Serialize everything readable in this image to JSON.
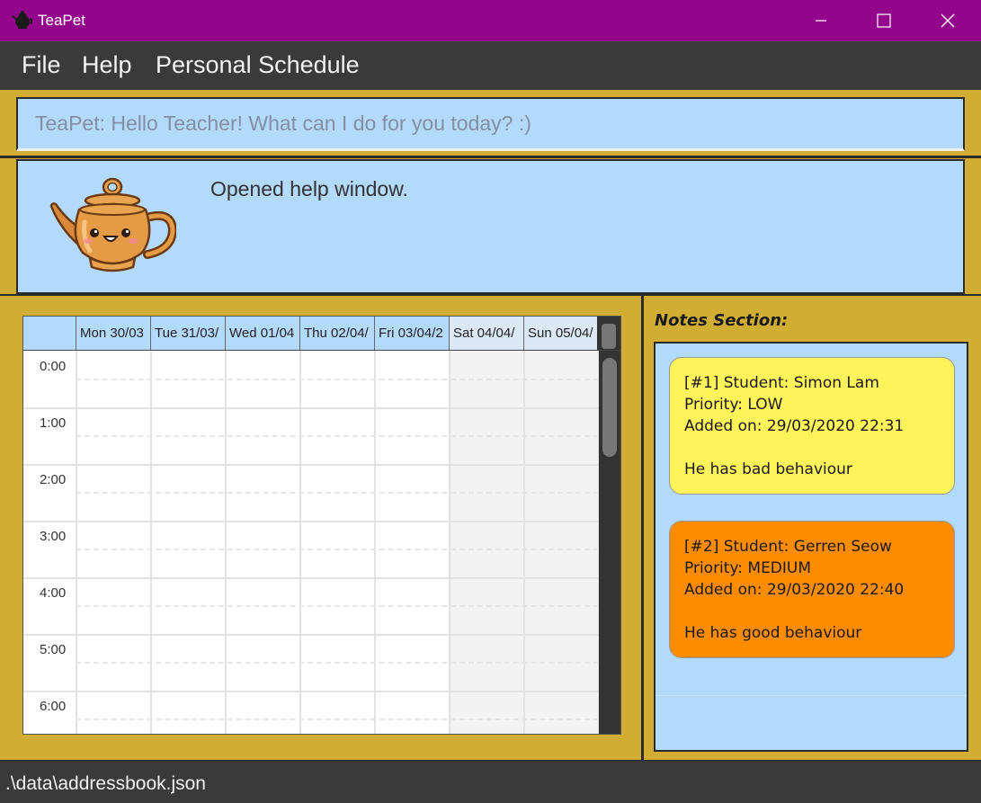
{
  "window": {
    "title": "TeaPet",
    "icon": "teapot-icon",
    "controls": {
      "minimize": "minimize-icon",
      "maximize": "maximize-icon",
      "close": "close-icon"
    }
  },
  "menu": {
    "file": "File",
    "help": "Help",
    "schedule": "Personal Schedule"
  },
  "command": {
    "placeholder": "TeaPet: Hello Teacher! What can I do for you today? :)",
    "value": ""
  },
  "result": {
    "message": "Opened help window.",
    "mascot": "teapot-mascot"
  },
  "calendar": {
    "days": [
      {
        "label": "Mon 30/03",
        "weekend": false
      },
      {
        "label": "Tue 31/03/",
        "weekend": false
      },
      {
        "label": "Wed 01/04",
        "weekend": false
      },
      {
        "label": "Thu 02/04/",
        "weekend": false
      },
      {
        "label": "Fri 03/04/2",
        "weekend": false
      },
      {
        "label": "Sat 04/04/",
        "weekend": true
      },
      {
        "label": "Sun 05/04/",
        "weekend": true
      }
    ],
    "times": [
      "0:00",
      "1:00",
      "2:00",
      "3:00",
      "4:00",
      "5:00",
      "6:00"
    ]
  },
  "notes": {
    "title": "Notes Section:",
    "items": [
      {
        "header": "[#1] Student: Simon Lam",
        "priority": "Priority: LOW",
        "added": "Added on: 29/03/2020 22:31",
        "content": "He has bad behaviour",
        "color": "#fef35a"
      },
      {
        "header": "[#2] Student: Gerren Seow",
        "priority": "Priority: MEDIUM",
        "added": "Added on: 29/03/2020 22:40",
        "content": "He has good behaviour",
        "color": "#fd8c00"
      }
    ]
  },
  "status": {
    "path": ".\\data\\addressbook.json"
  },
  "colors": {
    "title_bar": "#93058a",
    "frame": "#d1ad34",
    "panel": "#b3d9fb",
    "menu_bar": "#3a3a3a"
  }
}
